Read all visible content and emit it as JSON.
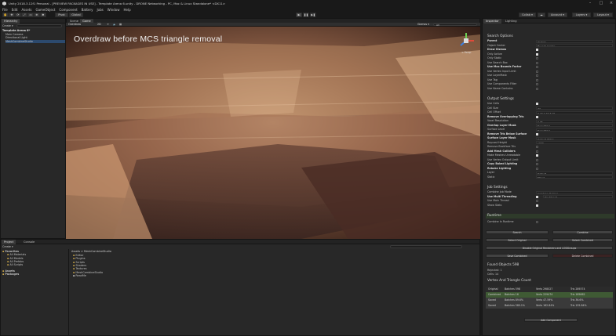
{
  "window": {
    "title": "Unity 2018.3.12f1 Personal - [PREVIEW PACKAGES IN USE] - Template Arena 6.unity - DRONE Networking - PC, Mac & Linux Standalone* <DX11>"
  },
  "menu": [
    "File",
    "Edit",
    "Assets",
    "GameObject",
    "Component",
    "Battery",
    "Jobs",
    "Window",
    "Help"
  ],
  "toolbar": {
    "pivot": "Pivot",
    "global": "Global",
    "collab": "Collab ▾",
    "account": "Account ▾",
    "layers": "Layers ▾",
    "layout": "Layout ▾"
  },
  "hierarchy": {
    "tab": "Hierarchy",
    "create": "Create ▾",
    "rows": [
      {
        "label": "Template Arena 6*",
        "bold": true
      },
      {
        "label": "Main Camera",
        "bold": false
      },
      {
        "label": "Directional Light",
        "bold": false
      },
      {
        "label": "MeshCombineStudio",
        "bold": false
      }
    ]
  },
  "scene": {
    "tabs": [
      "Scene",
      "Game"
    ],
    "shading": "Overdraw",
    "mode": "2D",
    "gizmos": "Gizmos ▾",
    "search": "All",
    "overlay_title": "Overdraw before MCS triangle removal",
    "persp": "< Persp"
  },
  "project": {
    "tabs": [
      "Project",
      "Console"
    ],
    "create": "Create ▾",
    "breadcrumb": "Assets > MeshCombineStudio",
    "favorites": [
      "Favorites",
      "All Materials",
      "All Models",
      "All Prefabs",
      "All Scripts"
    ],
    "roots": [
      "Assets",
      "Packages"
    ],
    "folders": [
      "Editor",
      "Plugins",
      "Scripts",
      "Shaders",
      "Textures",
      "MeshCombineStudio",
      "ReadMe"
    ]
  },
  "inspector": {
    "tabs": [
      "Inspector",
      "Lighting"
    ],
    "sections": {
      "search": "Search Options",
      "output": "Output Settings",
      "job": "Job Settings",
      "runtime": "Runtime",
      "found": "Found Objects 598",
      "vt": "Vertex And Triangle Count"
    },
    "search_rows": [
      {
        "label": "Parent",
        "value": "Prefabs",
        "bold": true
      },
      {
        "label": "Object Center",
        "value": "Bounds Center"
      },
      {
        "label": "Draw Gizmos",
        "check": true,
        "bold": true
      },
      {
        "label": "Only Active",
        "check": true
      },
      {
        "label": "Only Static",
        "check": false
      },
      {
        "label": "Use Search Box",
        "check": false
      },
      {
        "label": "Use Max Bounds Factor",
        "check": false,
        "bold": true
      },
      {
        "label": "Use Vertex Input Limit",
        "check": false
      },
      {
        "label": "Use LayerMask",
        "check": false
      },
      {
        "label": "Use Tag",
        "check": false
      },
      {
        "label": "Use Components Filter",
        "check": false
      },
      {
        "label": "Use Name Contains",
        "check": false
      }
    ],
    "output_rows": [
      {
        "label": "Use Cells",
        "check": true
      },
      {
        "label": "Cell Size",
        "value": "32"
      },
      {
        "label": "Cell Offset",
        "value": "X 16   Y 16   Z 16"
      },
      {
        "label": "Remove Overlapping Tris",
        "check": true,
        "bold": true
      },
      {
        "label": "Voxel Resolution",
        "value": "0.05"
      },
      {
        "label": "Overlap Layer Mask",
        "value": "Everything",
        "bold": true
      },
      {
        "label": "Surface Level",
        "value": "Everything"
      },
      {
        "label": "Remove Tris Below Surface",
        "check": true,
        "bold": true
      },
      {
        "label": "Surface Layer Mask",
        "value": "Default,Water",
        "bold": true
      },
      {
        "label": "Raycast Height",
        "value": "1000"
      },
      {
        "label": "Remove Backface Tris",
        "check": false
      },
      {
        "label": "Add Mesh Colliders",
        "check": false,
        "bold": true
      },
      {
        "label": "Make Meshes Unreadable",
        "check": true
      },
      {
        "label": "Use Vertex Output Limit",
        "check": false
      },
      {
        "label": "Copy Baked Lighting",
        "check": false,
        "bold": true
      },
      {
        "label": "Rebake Lighting",
        "check": false,
        "bold": true
      },
      {
        "label": "Layer",
        "value": "Default"
      },
      {
        "label": "Static",
        "value": "Mixed..."
      }
    ],
    "job_rows": [
      {
        "label": "Combine Job Mode",
        "value": "Combine At Once"
      },
      {
        "label": "Use Multi Threading",
        "value": "Per Thread",
        "check": true,
        "bold": true
      },
      {
        "label": "Use Main Thread",
        "check": false
      },
      {
        "label": "Show Stats",
        "check": true
      }
    ],
    "runtime_row": {
      "label": "Combine In Runtime",
      "check": false
    },
    "buttons": {
      "search": "Search",
      "combine": "Combine",
      "select_original": "Select Original",
      "select_combined": "Select Combined",
      "disable_original": "Disable Original Renderers and LODGroups",
      "save_combined": "Save Combined",
      "delete_combined": "Delete Combined",
      "add_component": "Add Component"
    },
    "found_rows": [
      "Rejected: 1",
      "Cells: 14"
    ],
    "stats": [
      {
        "label": "Original",
        "batches": "Batches 598",
        "verts": "Verts 298027",
        "tris": "Tris 289374"
      },
      {
        "label": "Combined",
        "batches": "Batches 16",
        "verts": "Verts 229474",
        "tris": "Tris 185662"
      },
      {
        "label": "Saved",
        "batches": "Batches 89.6%",
        "verts": "Verts 47.59%",
        "tris": "Tris 36.6%"
      },
      {
        "label": "Saved",
        "batches": "Batches 580.1%",
        "verts": "Verts 162.84%",
        "tris": "Tris 155.84%"
      }
    ],
    "accent": "#6fa35c"
  }
}
